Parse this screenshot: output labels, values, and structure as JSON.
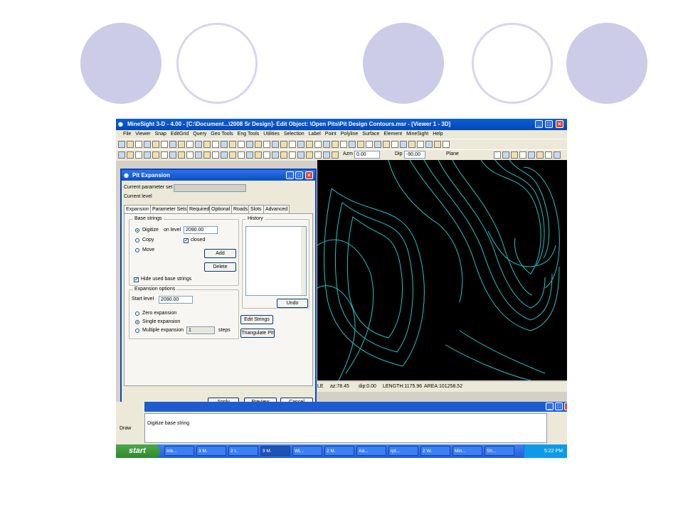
{
  "window": {
    "title": "MineSight 3-D - 4.00 - [C:\\Document...\\2008 Sr Design]- Edit Object: \\Open Pits\\Pit Design Contours.msr - [Viewer 1 - 3D]"
  },
  "menu": [
    "File",
    "Viewer",
    "Snap",
    "EditGrid",
    "Query",
    "Geo Tools",
    "Eng Tools",
    "Utilities",
    "Selection",
    "Label",
    "Point",
    "Polyline",
    "Surface",
    "Element",
    "MineSight",
    "Help"
  ],
  "viewer_toolbar": {
    "azm_label": "Azm",
    "azm_value": "0.00",
    "dip_label": "Dip",
    "dip_value": "-90.00",
    "plane_label": "Plane"
  },
  "dialog": {
    "title": "Pit Expansion",
    "current_parameter_set_label": "Current parameter set",
    "current_level_label": "Current level",
    "tabs": [
      "Expansion",
      "Parameter Sets",
      "Required",
      "Optional",
      "Roads",
      "Slots",
      "Advanced"
    ],
    "base_strings": {
      "legend": "Base strings",
      "digitize": "Digitize",
      "on_level_label": "on level",
      "on_level_value": "2090.00",
      "copy": "Copy",
      "closed": "closed",
      "move": "Move",
      "add": "Add",
      "delete": "Delete",
      "hide_used": "Hide used base strings"
    },
    "history": {
      "legend": "History",
      "undo": "Undo"
    },
    "expansion_options": {
      "legend": "Expansion options",
      "start_level_label": "Start level",
      "start_level_value": "2090.00",
      "zero": "Zero expansion",
      "single": "Single expansion",
      "multiple": "Multiple expansion",
      "multiple_value": "1",
      "steps": "steps"
    },
    "edit_strings": "Edit Strings",
    "triangulate_pit": "Triangulate Pit",
    "apply": "Apply",
    "preview": "Preview",
    "cancel": "Cancel"
  },
  "status_strip": {
    "text_left": "LE",
    "az": "az:78.45",
    "dip": "dip:0.00",
    "length": "LENGTH:1175.96",
    "area": "AREA:101258.52"
  },
  "command": {
    "draw_label": "Draw",
    "message": "Digitize base string"
  },
  "taskbar": {
    "start": "start",
    "tasks": [
      "Inb...",
      "3 M.",
      "2 I..",
      "9 M.",
      "Wi...",
      "2 M.",
      "Ad...",
      "rpt...",
      "2 W.",
      "Min...",
      "Sh..."
    ],
    "clock": "5:22 PM"
  },
  "colors": {
    "contour": "#21c4c4",
    "viewer_bg": "#000000",
    "circle_fill": "#cccce8"
  }
}
